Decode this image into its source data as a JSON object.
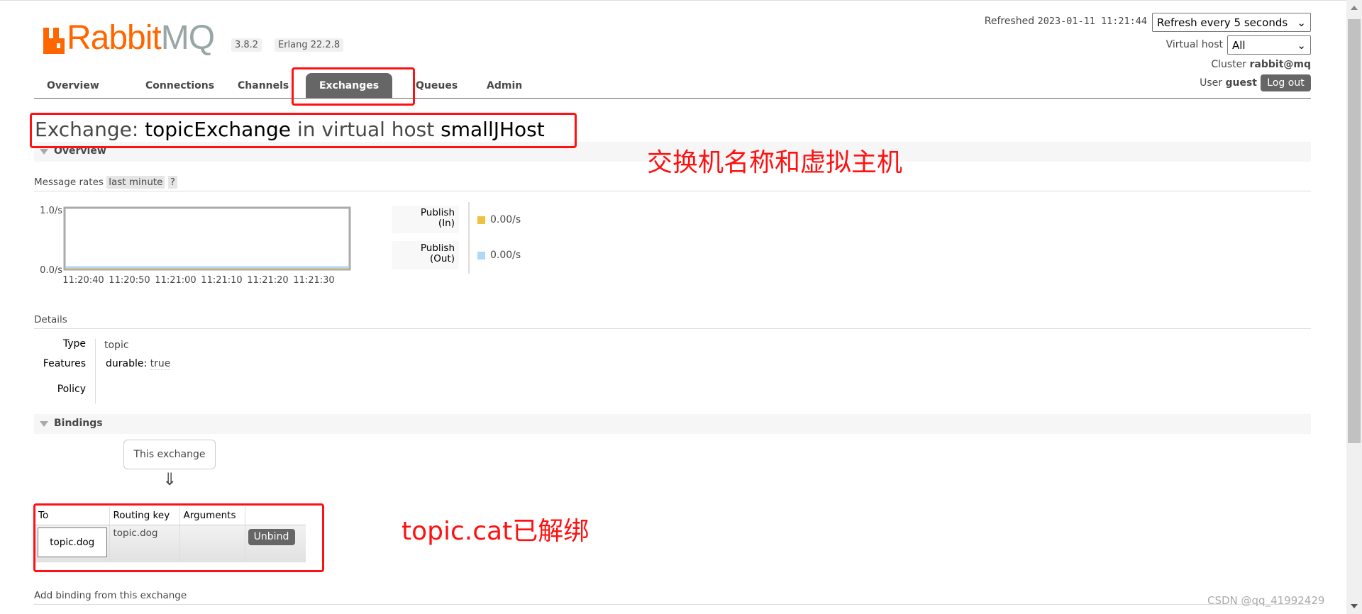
{
  "header": {
    "logo_text": "RabbitMQ",
    "version": "3.8.2",
    "erlang": "Erlang 22.2.8",
    "refreshed_label": "Refreshed",
    "refreshed_time": "2023-01-11 11:21:44",
    "refresh_select": "Refresh every 5 seconds",
    "vhost_label": "Virtual host",
    "vhost_select": "All",
    "cluster_label": "Cluster",
    "cluster_name": "rabbit@mq",
    "user_label": "User",
    "user_name": "guest",
    "logout": "Log out"
  },
  "nav": {
    "items": [
      "Overview",
      "Connections",
      "Channels",
      "Exchanges",
      "Queues",
      "Admin"
    ],
    "active": "Exchanges"
  },
  "title": {
    "prefix": "Exchange:",
    "name": "topicExchange",
    "mid": "in virtual host",
    "vhost": "smallJHost"
  },
  "overview": {
    "section": "Overview",
    "message_rates": "Message rates",
    "range": "last minute",
    "help": "?",
    "chart_data": {
      "type": "line",
      "y_ticks": [
        "1.0/s",
        "0.0/s"
      ],
      "ylim": [
        0,
        1
      ],
      "x_ticks": [
        "11:20:40",
        "11:20:50",
        "11:21:00",
        "11:21:10",
        "11:21:20",
        "11:21:30"
      ],
      "series": [
        {
          "name": "Publish (In)",
          "color": "#edc240",
          "values": [
            0,
            0,
            0,
            0,
            0,
            0
          ]
        },
        {
          "name": "Publish (Out)",
          "color": "#afd8f8",
          "values": [
            0,
            0,
            0,
            0,
            0,
            0
          ]
        }
      ]
    },
    "legend": [
      {
        "label1": "Publish",
        "label2": "(In)",
        "value": "0.00/s",
        "color": "#edc240"
      },
      {
        "label1": "Publish",
        "label2": "(Out)",
        "value": "0.00/s",
        "color": "#afd8f8"
      }
    ]
  },
  "details": {
    "heading": "Details",
    "type_label": "Type",
    "type_value": "topic",
    "features_label": "Features",
    "durable_key": "durable:",
    "durable_value": "true",
    "policy_label": "Policy"
  },
  "bindings": {
    "section": "Bindings",
    "this_exchange": "This exchange",
    "arrow": "⇓",
    "columns": [
      "To",
      "Routing key",
      "Arguments",
      ""
    ],
    "rows": [
      {
        "to": "topic.dog",
        "routing_key": "topic.dog",
        "arguments": "",
        "action": "Unbind"
      }
    ],
    "add_binding": "Add binding from this exchange"
  },
  "annotations": {
    "title_note": "交换机名称和虚拟主机",
    "binding_note": "topic.cat已解绑",
    "watermark": "CSDN @qq_41992429",
    "color": "#ff1111"
  }
}
